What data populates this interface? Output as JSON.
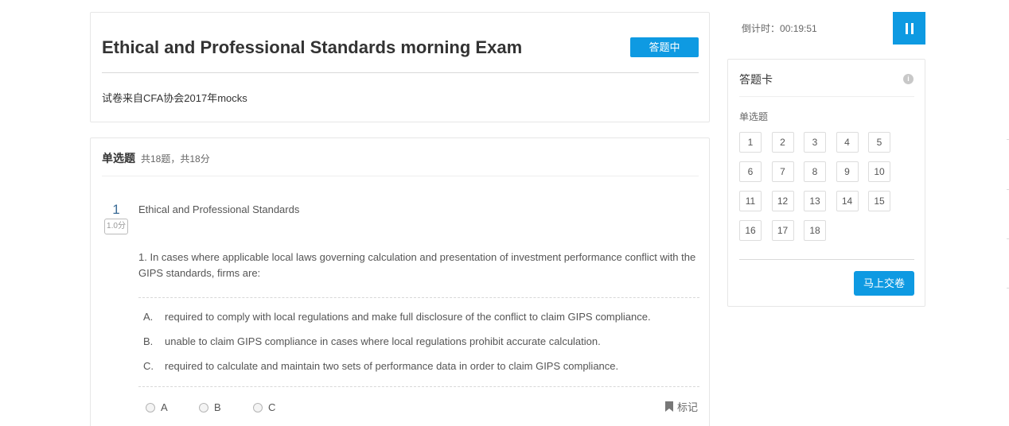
{
  "exam": {
    "title": "Ethical and Professional Standards morning Exam",
    "status": "答题中",
    "description": "试卷来自CFA协会2017年mocks"
  },
  "section": {
    "title": "单选题",
    "meta": "共18题，共18分"
  },
  "question": {
    "number": "1",
    "score": "1.0分",
    "category": "Ethical and Professional Standards",
    "stem": "1. In cases where applicable local laws governing calculation and presentation of investment performance conflict with the GIPS standards, firms are:",
    "options": [
      {
        "letter": "A.",
        "text": "required to comply with local regulations and make full disclosure of the conflict to claim GIPS compliance."
      },
      {
        "letter": "B.",
        "text": "unable to claim GIPS compliance in cases where local regulations prohibit accurate calculation."
      },
      {
        "letter": "C.",
        "text": "required to calculate and maintain two sets of performance data in order to claim GIPS compliance."
      }
    ],
    "answer_choices": [
      "A",
      "B",
      "C"
    ],
    "mark_label": "标记"
  },
  "timer": {
    "label": "倒计时：",
    "value": "00:19:51"
  },
  "answer_card": {
    "title": "答题卡",
    "type_label": "单选题",
    "numbers": [
      "1",
      "2",
      "3",
      "4",
      "5",
      "6",
      "7",
      "8",
      "9",
      "10",
      "11",
      "12",
      "13",
      "14",
      "15",
      "16",
      "17",
      "18"
    ],
    "submit_label": "马上交卷"
  },
  "colors": {
    "accent": "#0e9ae2",
    "question_number": "#3a6b96"
  },
  "icons": [
    "pause-icon",
    "info-icon",
    "bookmark-icon"
  ]
}
